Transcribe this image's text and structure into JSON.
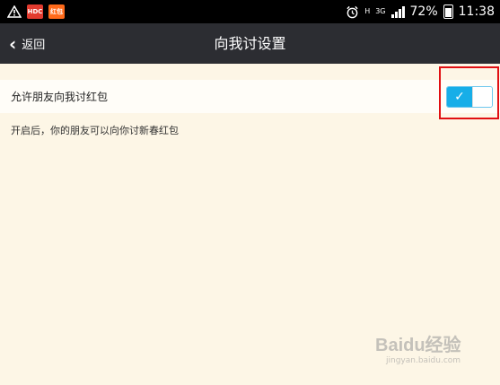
{
  "status_bar": {
    "app_badges": [
      {
        "label": "HDC",
        "color": "#e23b2f"
      },
      {
        "label": "红包",
        "color": "#ff6a1a"
      }
    ],
    "network": "3G",
    "network_h": "H",
    "battery": "72%",
    "time": "11:38"
  },
  "nav": {
    "back_label": "返回",
    "title": "向我讨设置"
  },
  "setting": {
    "label": "允许朋友向我讨红包",
    "toggle_on": true,
    "toggle_check": "✓"
  },
  "description": "开启后，你的朋友可以向你讨新春红包",
  "watermark": {
    "main": "Baidu经验",
    "sub": "jingyan.baidu.com"
  },
  "colors": {
    "toggle_accent": "#17aee8",
    "nav_bg": "#2c2d32",
    "highlight": "#e10f12",
    "page_bg": "#fdf6e6"
  }
}
